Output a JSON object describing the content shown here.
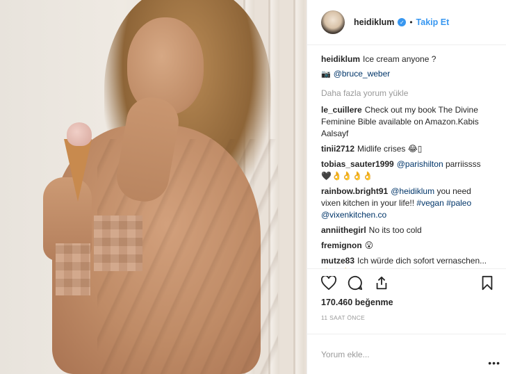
{
  "post": {
    "username": "heidiklum",
    "verified_icon": "check-icon",
    "follow_label": "Takip Et",
    "dot": "•",
    "caption": "Ice cream anyone ?",
    "photo_credit": "@bruce_weber",
    "load_more": "Daha fazla yorum yükle",
    "comments": [
      {
        "user": "le_cuillere",
        "text": "Check out my book The Divine Feminine Bible available on Amazon.Kabis Aalsayf"
      },
      {
        "user": "tinii2712",
        "text": "Midlife crises 😂▯"
      },
      {
        "user": "tobias_sauter1999",
        "mention": "@parishilton",
        "text": " parriissss 🖤👌👌👌👌"
      },
      {
        "user": "rainbow.bright91",
        "mention": "@heidiklum",
        "text": " you need vixen kitchen in your life!! ",
        "hashtags": "#vegan #paleo",
        "mention2": "@vixenkitchen.co"
      },
      {
        "user": "anniithegirl",
        "text": "No its too cold"
      },
      {
        "user": "fremignon",
        "text": "😮"
      },
      {
        "user": "mutze83",
        "text": "Ich würde dich sofort vernaschen...👌😊💪😎😮"
      }
    ],
    "likes": "170.460 beğenme",
    "time_ago": "11 SAAT ÖNCE",
    "comment_placeholder": "Yorum ekle...",
    "more_label": "•••",
    "icons": {
      "like": "heart-icon",
      "comment": "comment-icon",
      "share": "share-icon",
      "save": "bookmark-icon",
      "camera": "camera-icon"
    }
  }
}
